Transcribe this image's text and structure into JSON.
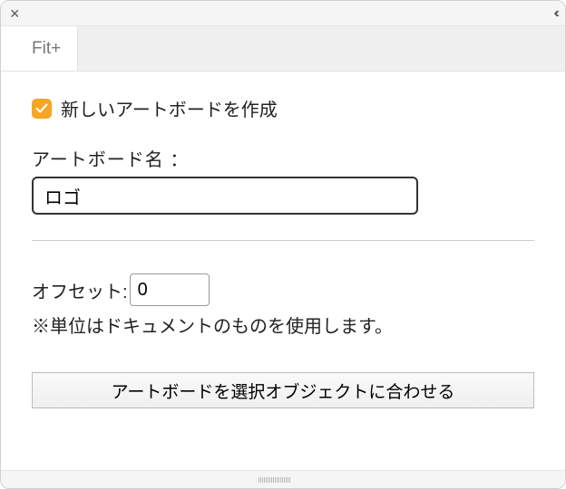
{
  "tab": {
    "label": "Fit+"
  },
  "checkbox": {
    "checked": true,
    "label": "新しいアートボードを作成"
  },
  "name": {
    "label": "アートボード名 ：",
    "value": "ロゴ"
  },
  "offset": {
    "label": "オフセット:",
    "value": "0"
  },
  "note": "※単位はドキュメントのものを使用します。",
  "button": {
    "label": "アートボードを選択オブジェクトに合わせる"
  }
}
